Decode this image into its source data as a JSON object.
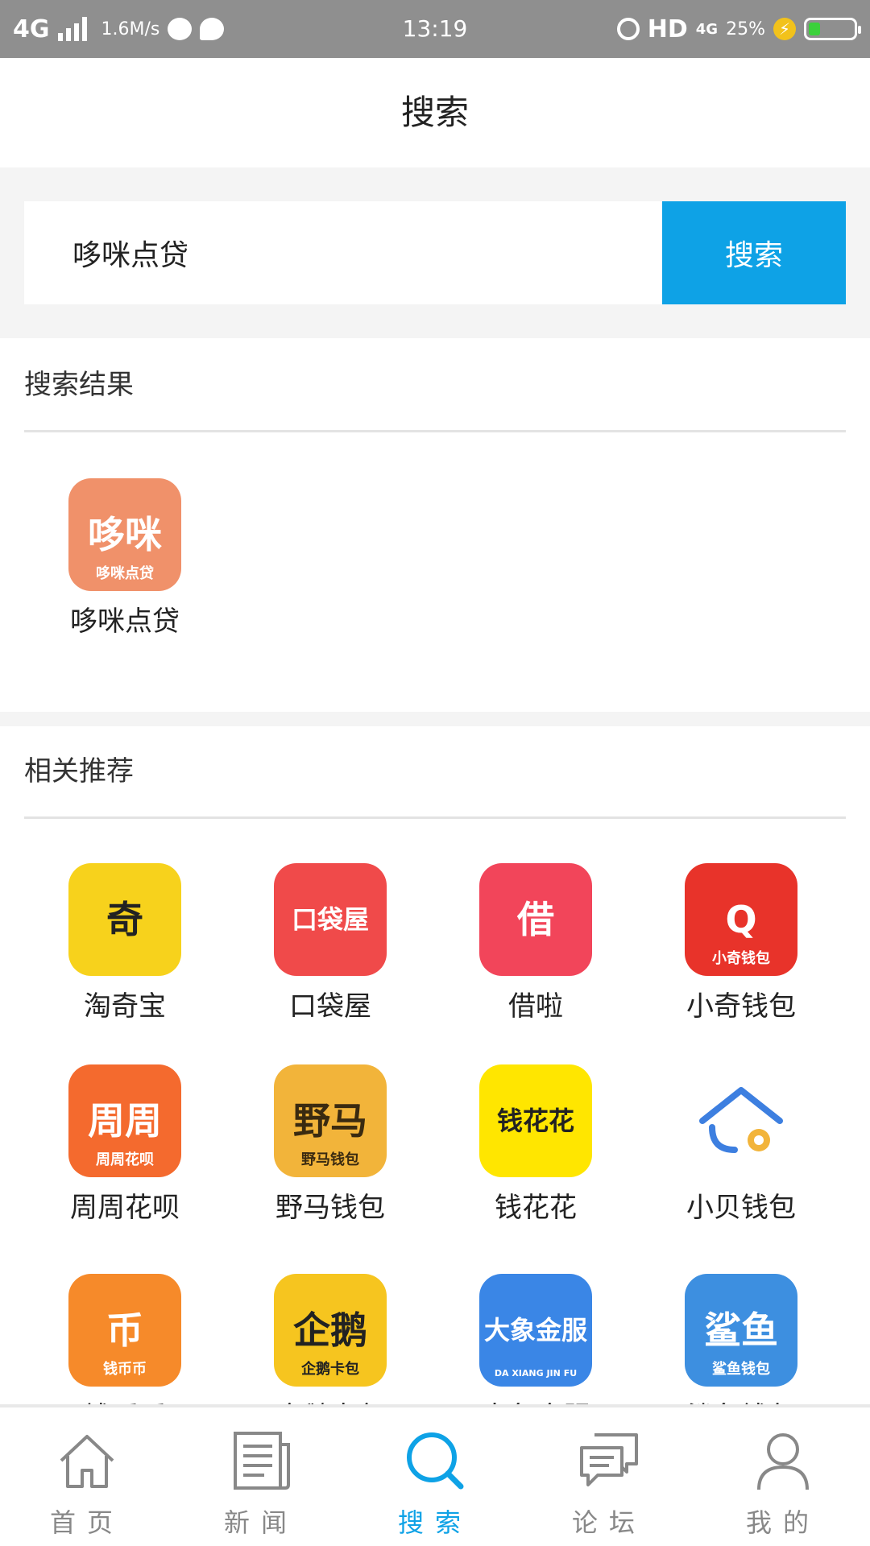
{
  "status_bar": {
    "network": "4G",
    "speed": "1.6M/s",
    "time": "13:19",
    "hd": "HD",
    "net_badge": "4G",
    "battery_percent": "25%",
    "battery_level": 0.25
  },
  "header": {
    "title": "搜索"
  },
  "search": {
    "value": "哆咪点贷",
    "button_label": "搜索"
  },
  "results": {
    "title": "搜索结果",
    "items": [
      {
        "label": "哆咪点贷",
        "icon_text": "哆咪",
        "icon_sub": "哆咪点贷",
        "color": "#f0916a"
      }
    ]
  },
  "recommend": {
    "title": "相关推荐",
    "items": [
      {
        "label": "淘奇宝",
        "icon_text": "奇",
        "icon_sub": "",
        "color": "#f7d21c",
        "text_color": "#222222"
      },
      {
        "label": "口袋屋",
        "icon_text": "口袋屋",
        "icon_sub": "",
        "color": "#f04a4a",
        "text_color": "#ffffff"
      },
      {
        "label": "借啦",
        "icon_text": "借",
        "icon_sub": "",
        "color": "#f2455a",
        "text_color": "#ffffff"
      },
      {
        "label": "小奇钱包",
        "icon_text": "Q",
        "icon_sub": "小奇钱包",
        "color": "#e8332a",
        "text_color": "#ffffff"
      },
      {
        "label": "周周花呗",
        "icon_text": "周周",
        "icon_sub": "周周花呗",
        "color": "#f46a2e",
        "text_color": "#ffffff"
      },
      {
        "label": "野马钱包",
        "icon_text": "野马",
        "icon_sub": "野马钱包",
        "color": "#f2b43a",
        "text_color": "#3a2a10"
      },
      {
        "label": "钱花花",
        "icon_text": "钱花花",
        "icon_sub": "",
        "color": "#ffe600",
        "text_color": "#222222"
      },
      {
        "label": "小贝钱包",
        "icon_text": "",
        "icon_sub": "",
        "color": "#ffffff",
        "text_color": "#3d7fe0"
      },
      {
        "label": "钱币币",
        "icon_text": "币",
        "icon_sub": "钱币币",
        "color": "#f68a2a",
        "text_color": "#ffffff"
      },
      {
        "label": "企鹅卡包",
        "icon_text": "企鹅",
        "icon_sub": "企鹅卡包",
        "color": "#f6c51f",
        "text_color": "#222222"
      },
      {
        "label": "大象金服",
        "icon_text": "大象金服",
        "icon_sub": "DA XIANG JIN FU",
        "color": "#3a86e6",
        "text_color": "#ffffff"
      },
      {
        "label": "鲨鱼钱包",
        "icon_text": "鲨鱼",
        "icon_sub": "鲨鱼钱包",
        "color": "#3d8fe0",
        "text_color": "#ffffff"
      }
    ]
  },
  "bottom_nav": {
    "items": [
      {
        "label": "首页",
        "icon": "home-icon"
      },
      {
        "label": "新闻",
        "icon": "news-icon"
      },
      {
        "label": "搜索",
        "icon": "search-icon",
        "active": true
      },
      {
        "label": "论坛",
        "icon": "forum-icon"
      },
      {
        "label": "我的",
        "icon": "profile-icon"
      }
    ],
    "active_color": "#0ea2e6",
    "inactive_color": "#888888"
  }
}
